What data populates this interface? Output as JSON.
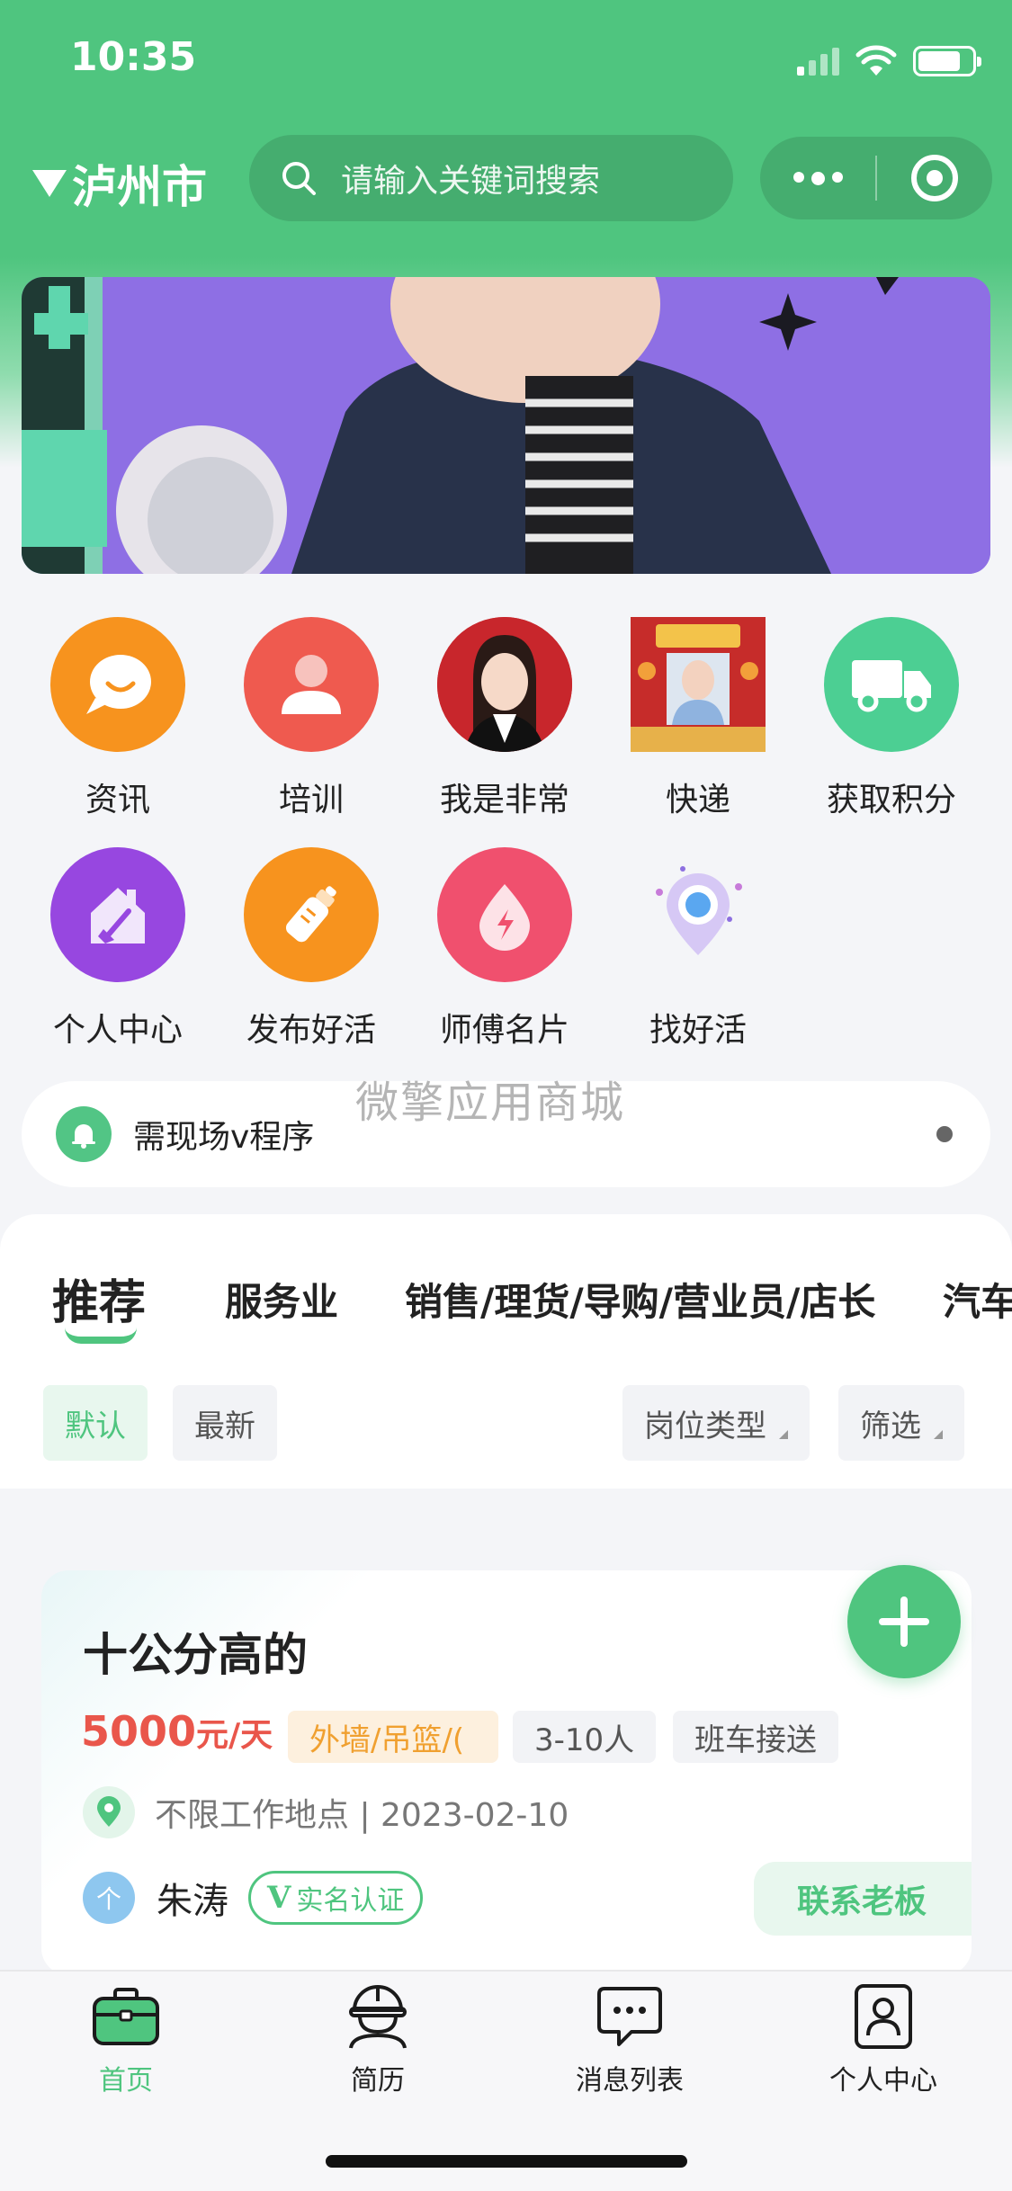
{
  "status_bar": {
    "time": "10:35"
  },
  "header": {
    "city": "泸州市",
    "search_placeholder": "请输入关键词搜索"
  },
  "grid": {
    "items": [
      {
        "label": "资讯",
        "color": "#f7931e"
      },
      {
        "label": "培训",
        "color": "#ef5a4f"
      },
      {
        "label": "我是非常"
      },
      {
        "label": "快递"
      },
      {
        "label": "获取积分",
        "color": "#4ccf93"
      },
      {
        "label": "个人中心",
        "color": "#9747e0"
      },
      {
        "label": "发布好活",
        "color": "#f7931e"
      },
      {
        "label": "师傅名片",
        "color": "#f0506e"
      },
      {
        "label": "找好活"
      }
    ]
  },
  "notice": {
    "text": "需现场v程序"
  },
  "watermark": "微擎应用商城",
  "tabs": {
    "items": [
      "推荐",
      "服务业",
      "销售/理货/导购/营业员/店长",
      "汽车"
    ],
    "filters": {
      "default": "默认",
      "latest": "最新",
      "job_type": "岗位类型",
      "filter": "筛选"
    }
  },
  "job": {
    "title": "十公分高的",
    "salary_num": "5000",
    "salary_unit": "元/天",
    "tags": [
      "外墙/吊篮/(",
      "3-10人",
      "班车接送"
    ],
    "location": "不限工作地点 | 2023-02-10",
    "avatar_text": "个",
    "boss_name": "朱涛",
    "verify_v": "V",
    "verify_text": "实名认证",
    "contact": "联系老板"
  },
  "tabbar": {
    "items": [
      "首页",
      "简历",
      "消息列表",
      "个人中心"
    ]
  },
  "colors": {
    "brand": "#4fc57f",
    "salary": "#e9564b"
  }
}
